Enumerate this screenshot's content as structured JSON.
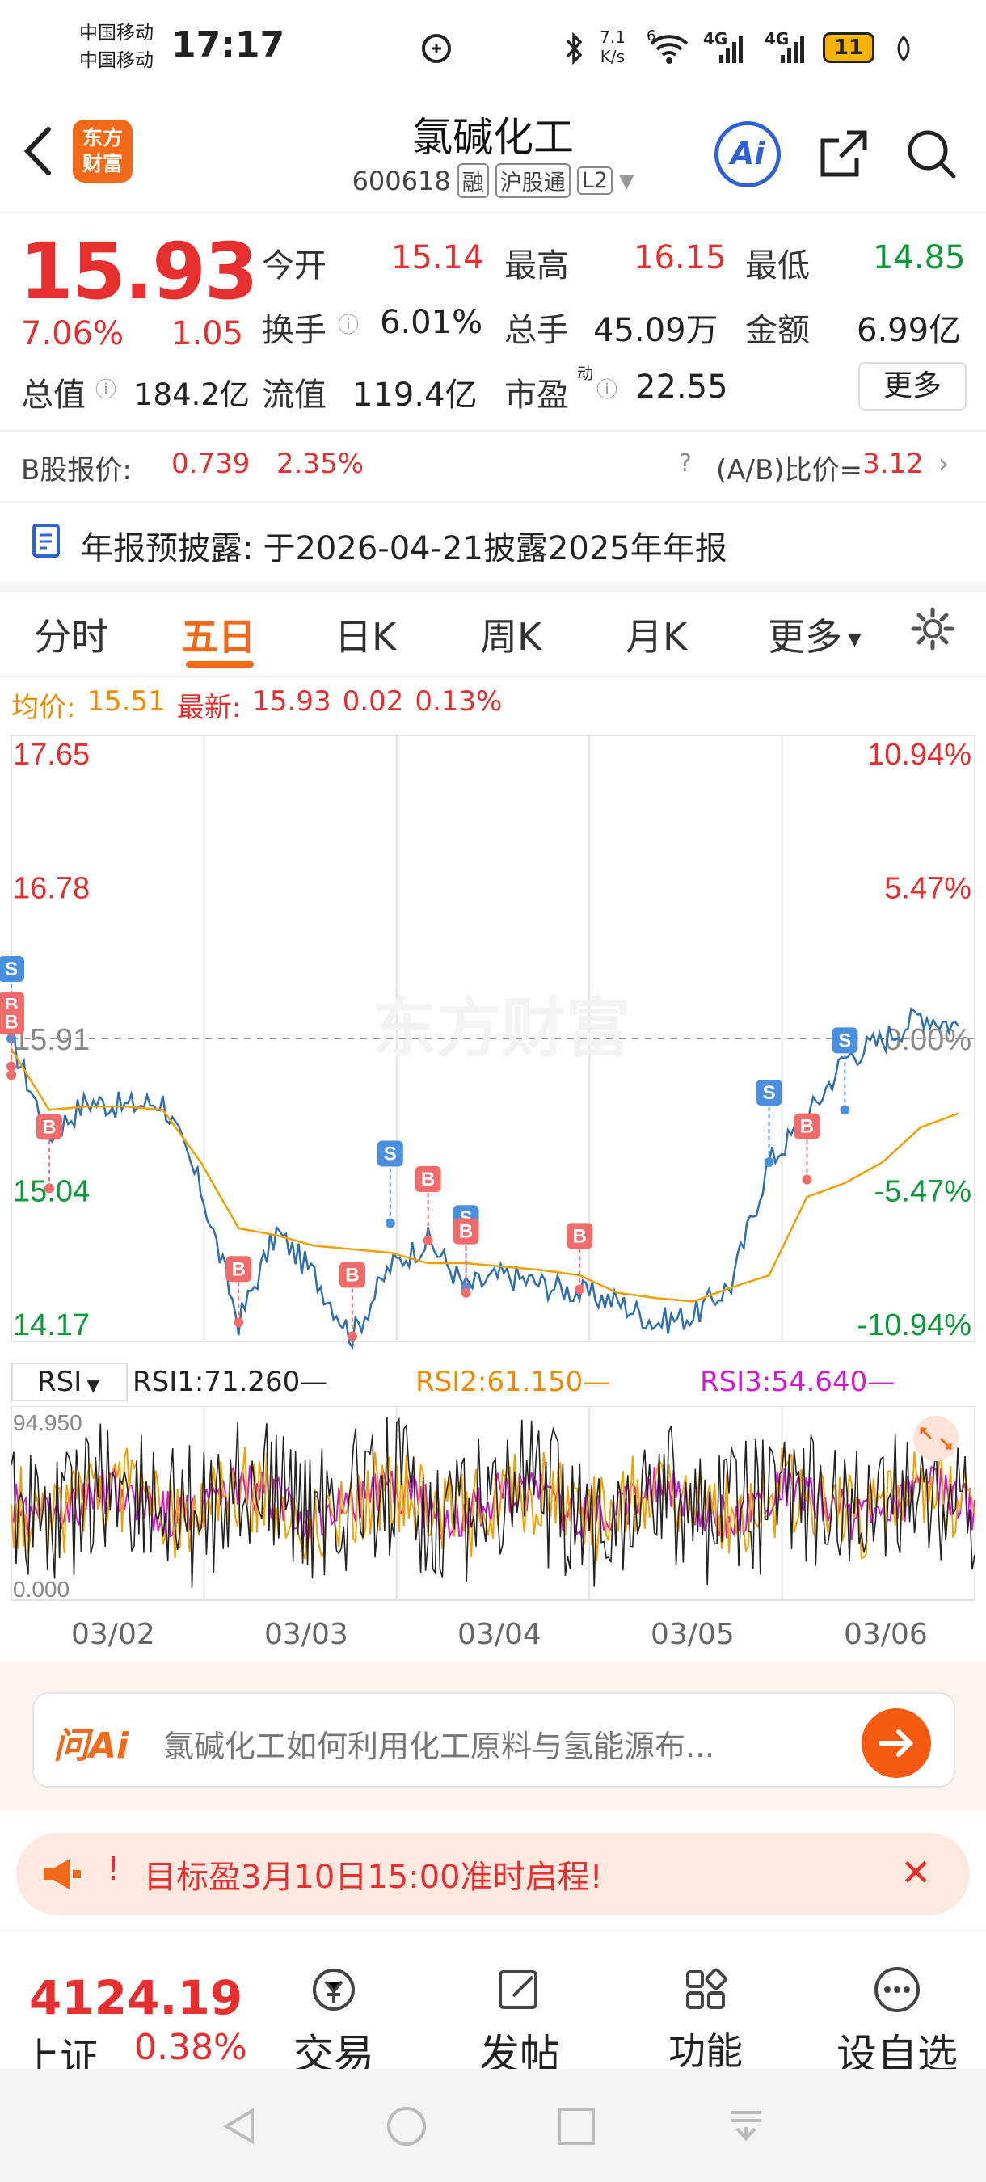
{
  "status_bar": {
    "carrier_1": "中国移动",
    "carrier_2": "中国移动",
    "time": "17:17",
    "net_speed_value": "7.1",
    "net_speed_unit": "K/s",
    "sim1": "4G",
    "sim2": "4G",
    "wifi_badge": "6",
    "battery": "11"
  },
  "header": {
    "logo_line1": "东方",
    "logo_line2": "财富",
    "title": "氯碱化工",
    "code": "600618",
    "tag_margin": "融",
    "tag_connect": "沪股通",
    "tag_level": "L2",
    "ai_label": "Ai"
  },
  "quote": {
    "price": "15.93",
    "change_pct": "7.06%",
    "change_amt": "1.05",
    "open_label": "今开",
    "open": "15.14",
    "high_label": "最高",
    "high": "16.15",
    "low_label": "最低",
    "low": "14.85",
    "turnover_label": "换手",
    "turnover": "6.01%",
    "volume_label": "总手",
    "volume": "45.09万",
    "amount_label": "金额",
    "amount": "6.99亿",
    "mktcap_label": "总值",
    "mktcap": "184.2亿",
    "float_label": "流值",
    "float_cap": "119.4亿",
    "pe_label": "市盈",
    "pe_sup": "动",
    "pe": "22.55",
    "more_label": "更多"
  },
  "bshare": {
    "label": "B股报价:",
    "price": "0.739",
    "pct": "2.35%",
    "ratio_label": "(A/B)比价=",
    "ratio": "3.12"
  },
  "notice": {
    "label": "年报预披露:",
    "text": "于2026-04-21披露2025年年报"
  },
  "tabs": [
    "分时",
    "五日",
    "日K",
    "周K",
    "月K",
    "更多"
  ],
  "active_tab": "五日",
  "chart_info": {
    "avg_label": "均价:",
    "avg": "15.51",
    "latest_label": "最新:",
    "latest": "15.93",
    "chg": "0.02",
    "chg_pct": "0.13%",
    "watermark": "东方财富"
  },
  "chart_data": {
    "type": "line",
    "title": "",
    "x": [
      "03/02",
      "03/03",
      "03/04",
      "03/05",
      "03/06"
    ],
    "y_ticks_left": [
      "17.65",
      "16.78",
      "15.91",
      "15.04",
      "14.17"
    ],
    "y_ticks_right": [
      "10.94%",
      "5.47%",
      "0.00%",
      "-5.47%",
      "-10.94%"
    ],
    "ylim": [
      14.17,
      17.65
    ],
    "reference_price": 15.91,
    "grid": true,
    "series": [
      {
        "name": "",
        "color": "#2f6fb0",
        "values": [
          15.9,
          15.35,
          15.55,
          15.52,
          15.55,
          15.05,
          14.28,
          14.8,
          14.55,
          14.2,
          14.6,
          14.75,
          14.48,
          14.55,
          14.5,
          14.45,
          14.4,
          14.28,
          14.32,
          14.5,
          15.2,
          15.45,
          15.8,
          15.9,
          16.05,
          15.98
        ]
      },
      {
        "name": "",
        "color": "#f0a000",
        "values": [
          15.85,
          15.5,
          15.52,
          15.52,
          15.5,
          15.2,
          14.82,
          14.78,
          14.72,
          14.7,
          14.68,
          14.62,
          14.62,
          14.6,
          14.58,
          14.55,
          14.45,
          14.42,
          14.4,
          14.48,
          14.55,
          15.0,
          15.08,
          15.2,
          15.4,
          15.48
        ]
      }
    ],
    "trade_marks": [
      {
        "type": "S",
        "x_index": 0,
        "y": 15.91
      },
      {
        "type": "B",
        "x_index": 0,
        "y": 15.75
      },
      {
        "type": "B",
        "x_index": 0,
        "y": 15.7
      },
      {
        "type": "B",
        "x_index": 1,
        "y": 15.05
      },
      {
        "type": "B",
        "x_index": 6,
        "y": 14.28
      },
      {
        "type": "B",
        "x_index": 9,
        "y": 14.2
      },
      {
        "type": "S",
        "x_index": 10,
        "y": 14.85
      },
      {
        "type": "B",
        "x_index": 11,
        "y": 14.75
      },
      {
        "type": "S",
        "x_index": 12,
        "y": 14.48
      },
      {
        "type": "B",
        "x_index": 12,
        "y": 14.45
      },
      {
        "type": "B",
        "x_index": 15,
        "y": 14.47
      },
      {
        "type": "S",
        "x_index": 20,
        "y": 15.2
      },
      {
        "type": "B",
        "x_index": 21,
        "y": 15.1
      },
      {
        "type": "S",
        "x_index": 22,
        "y": 15.5
      }
    ]
  },
  "rsi": {
    "selector": "RSI",
    "rsi1": "RSI1:71.260",
    "rsi2": "RSI2:61.150",
    "rsi3": "RSI3:54.640",
    "max_label": "94.950",
    "min_label": "0.000",
    "colors": {
      "rsi1": "#222222",
      "rsi2": "#f0a000",
      "rsi3": "#d319d3"
    }
  },
  "x_axis": [
    "03/02",
    "03/03",
    "03/04",
    "03/05",
    "03/06"
  ],
  "ask_ai": {
    "logo": "问Ai",
    "placeholder": "氯碱化工如何利用化工原料与氢能源布..."
  },
  "banner": {
    "prefix": "!",
    "text": "目标盈3月10日15:00准时启程!"
  },
  "index": {
    "value": "4124.19",
    "name": "上证",
    "pct": "0.38%"
  },
  "nav": [
    {
      "label": "交易",
      "icon": "yen-exchange-icon"
    },
    {
      "label": "发帖",
      "icon": "edit-icon"
    },
    {
      "label": "功能",
      "icon": "grid-icon"
    },
    {
      "label": "设自选",
      "icon": "more-dots-icon"
    }
  ],
  "colors": {
    "up": "#e5302f",
    "down": "#0a9a38",
    "accent": "#f06a1a",
    "line": "#2f6fb0",
    "avg": "#f0a000"
  }
}
